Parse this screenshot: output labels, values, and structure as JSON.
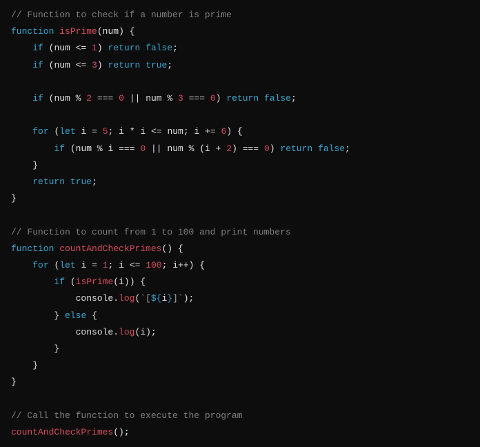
{
  "code": {
    "line1_comment": "// Function to check if a number is prime",
    "line2_kw_function": "function",
    "line2_fname": "isPrime",
    "line2_param": "num",
    "line3_kw_if": "if",
    "line3_num": "num",
    "line3_op": "<=",
    "line3_val": "1",
    "line3_kw_return": "return",
    "line3_bool": "false",
    "line4_kw_if": "if",
    "line4_num": "num",
    "line4_op": "<=",
    "line4_val": "3",
    "line4_kw_return": "return",
    "line4_bool": "true",
    "line6_kw_if": "if",
    "line6_num1": "num",
    "line6_mod1": "%",
    "line6_two": "2",
    "line6_eq1": "===",
    "line6_zero1": "0",
    "line6_or": "||",
    "line6_num2": "num",
    "line6_mod2": "%",
    "line6_three": "3",
    "line6_eq2": "===",
    "line6_zero2": "0",
    "line6_kw_return": "return",
    "line6_bool": "false",
    "line8_kw_for": "for",
    "line8_kw_let": "let",
    "line8_i": "i",
    "line8_eq": "=",
    "line8_five": "5",
    "line8_i2": "i",
    "line8_mul": "*",
    "line8_i3": "i",
    "line8_le": "<=",
    "line8_num": "num",
    "line8_i4": "i",
    "line8_pe": "+=",
    "line8_six": "6",
    "line9_kw_if": "if",
    "line9_num1": "num",
    "line9_mod1": "%",
    "line9_i1": "i",
    "line9_eq1": "===",
    "line9_zero1": "0",
    "line9_or": "||",
    "line9_num2": "num",
    "line9_mod2": "%",
    "line9_i2": "i",
    "line9_plus": "+",
    "line9_two": "2",
    "line9_eq2": "===",
    "line9_zero2": "0",
    "line9_kw_return": "return",
    "line9_bool": "false",
    "line11_kw_return": "return",
    "line11_bool": "true",
    "line14_comment": "// Function to count from 1 to 100 and print numbers",
    "line15_kw_function": "function",
    "line15_fname": "countAndCheckPrimes",
    "line16_kw_for": "for",
    "line16_kw_let": "let",
    "line16_i": "i",
    "line16_eq": "=",
    "line16_one": "1",
    "line16_i2": "i",
    "line16_le": "<=",
    "line16_hundred": "100",
    "line16_i3": "i",
    "line16_pp": "++",
    "line17_kw_if": "if",
    "line17_fname": "isPrime",
    "line17_i": "i",
    "line18_console": "console",
    "line18_log": "log",
    "line18_str1": "`[",
    "line18_tv_open": "${",
    "line18_tv_i": "i",
    "line18_tv_close": "}",
    "line18_str2": "]`",
    "line19_kw_else": "else",
    "line20_console": "console",
    "line20_log": "log",
    "line20_i": "i",
    "line25_comment": "// Call the function to execute the program",
    "line26_fname": "countAndCheckPrimes"
  }
}
